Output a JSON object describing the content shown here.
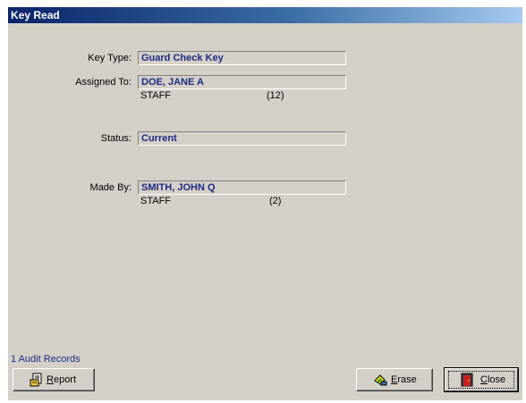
{
  "window": {
    "title": "Key Read"
  },
  "fields": {
    "key_type": {
      "label": "Key Type:",
      "value": "Guard Check Key"
    },
    "assigned_to": {
      "label": "Assigned To:",
      "value": "DOE, JANE A",
      "role": "STAFF",
      "count": "(12)"
    },
    "status": {
      "label": "Status:",
      "value": "Current"
    },
    "made_by": {
      "label": "Made By:",
      "value": "SMITH, JOHN Q",
      "role": "STAFF",
      "count": "(2)"
    }
  },
  "footer": {
    "audit_records": "1 Audit Records",
    "report_button": {
      "mnemonic": "R",
      "rest": "eport",
      "icon": "report-icon"
    },
    "erase_button": {
      "mnemonic": "E",
      "rest": "rase",
      "icon": "erase-icon"
    },
    "close_button": {
      "mnemonic": "C",
      "rest": "lose",
      "icon": "close-door-icon"
    }
  }
}
